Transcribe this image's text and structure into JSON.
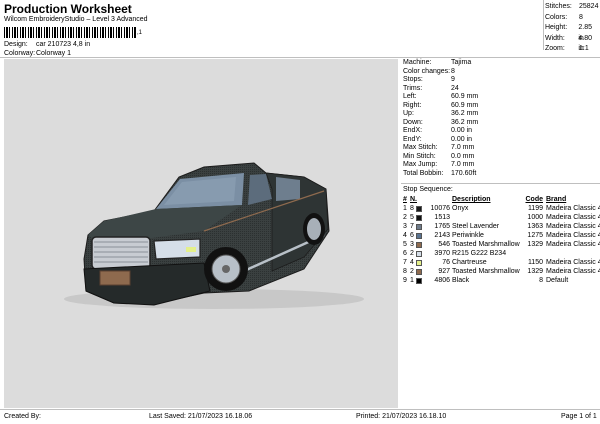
{
  "header": {
    "title": "Production Worksheet",
    "subtitle": "Wilcom EmbroideryStudio – Level 3 Advanced",
    "barcode_tail": ",1",
    "design_label": "Design:",
    "design_value": "car 210723 4,8 in",
    "colorway_label": "Colorway:",
    "colorway_value": "Colorway 1"
  },
  "summary": [
    {
      "label": "Stitches:",
      "value": "25824"
    },
    {
      "label": "Colors:",
      "value": "8"
    },
    {
      "label": "Height:",
      "value": "2.85 in"
    },
    {
      "label": "Width:",
      "value": "4.80 in"
    },
    {
      "label": "Zoom:",
      "value": "1:1"
    }
  ],
  "properties": [
    {
      "label": "Machine:",
      "value": "Tajima"
    },
    {
      "label": "Color changes:",
      "value": "8"
    },
    {
      "label": "Stops:",
      "value": "9"
    },
    {
      "label": "Trims:",
      "value": "24"
    },
    {
      "label": "Left:",
      "value": "60.9 mm"
    },
    {
      "label": "Right:",
      "value": "60.9 mm"
    },
    {
      "label": "Up:",
      "value": "36.2 mm"
    },
    {
      "label": "Down:",
      "value": "36.2 mm"
    },
    {
      "label": "EndX:",
      "value": "0.00 in"
    },
    {
      "label": "EndY:",
      "value": "0.00 in"
    },
    {
      "label": "Max Stitch:",
      "value": "7.0 mm"
    },
    {
      "label": "Min Stitch:",
      "value": "0.0 mm"
    },
    {
      "label": "Max Jump:",
      "value": "7.0 mm"
    },
    {
      "label": "Total Bobbin:",
      "value": "170.60ft"
    }
  ],
  "stop_sequence": {
    "title": "Stop Sequence:",
    "headers": {
      "hash": "#",
      "n": "N.",
      "description": "Description",
      "code": "Code",
      "brand": "Brand"
    },
    "rows": [
      {
        "num": "1",
        "n": "8",
        "color": "#1a1a1a",
        "stitches": "10076",
        "description": "Onyx",
        "code": "1199",
        "brand": "Madeira Classic 40"
      },
      {
        "num": "2",
        "n": "5",
        "color": "#111111",
        "stitches": "1513",
        "description": "",
        "code": "1000",
        "brand": "Madeira Classic 40"
      },
      {
        "num": "3",
        "n": "7",
        "color": "#6e7b8a",
        "stitches": "1765",
        "description": "Steel Lavender",
        "code": "1363",
        "brand": "Madeira Classic 40"
      },
      {
        "num": "4",
        "n": "6",
        "color": "#5a7390",
        "stitches": "2143",
        "description": "Periwinkle",
        "code": "1275",
        "brand": "Madeira Classic 40"
      },
      {
        "num": "5",
        "n": "3",
        "color": "#8e6a4e",
        "stitches": "546",
        "description": "Toasted Marshmallow",
        "code": "1329",
        "brand": "Madeira Classic 40"
      },
      {
        "num": "6",
        "n": "2",
        "color": "#d5dee8",
        "stitches": "3970",
        "description": "R215 G222 B234",
        "code": "",
        "brand": ""
      },
      {
        "num": "7",
        "n": "4",
        "color": "#e4f08a",
        "stitches": "76",
        "description": "Chartreuse",
        "code": "1150",
        "brand": "Madeira Classic 40"
      },
      {
        "num": "8",
        "n": "2",
        "color": "#8e6a4e",
        "stitches": "927",
        "description": "Toasted Marshmallow",
        "code": "1329",
        "brand": "Madeira Classic 40"
      },
      {
        "num": "9",
        "n": "1",
        "color": "#000000",
        "stitches": "4806",
        "description": "Black",
        "code": "8",
        "brand": "Default"
      }
    ]
  },
  "footer": {
    "created_by": "Created By:",
    "last_saved": "Last Saved: 21/07/2023 16.18.06",
    "printed": "Printed: 21/07/2023 16.18.10",
    "page": "Page 1 of 1"
  }
}
